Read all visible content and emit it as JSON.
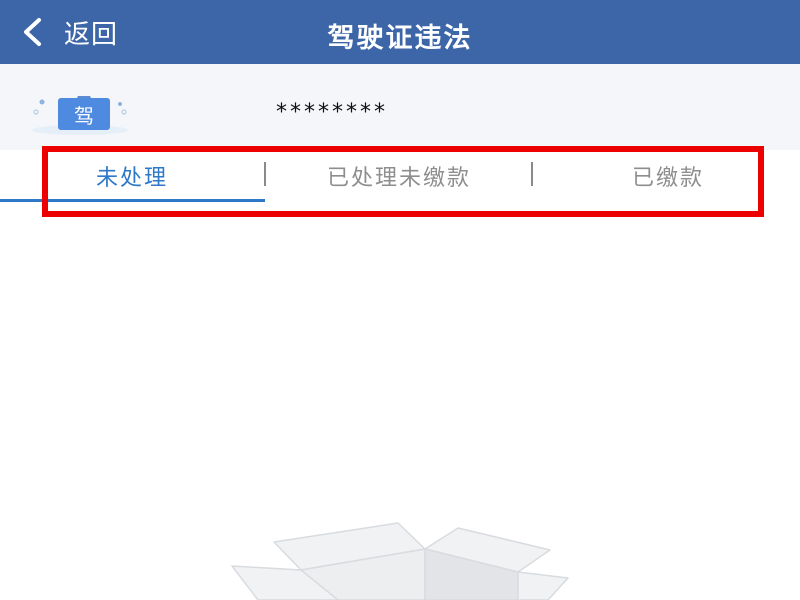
{
  "navbar": {
    "back_label": "返回",
    "title": "驾驶证违法",
    "background_color": "#3C66A8",
    "back_icon": "chevron-left-icon"
  },
  "license": {
    "badge_text": "驾",
    "badge_icon": "driver-license-icon",
    "masked_number": "********"
  },
  "tabs": [
    {
      "label": "未处理",
      "active": true
    },
    {
      "label": "已处理未缴款",
      "active": false
    },
    {
      "label": "已缴款",
      "active": false
    }
  ],
  "colors": {
    "accent": "#2F78C8",
    "inactive_tab": "#8E8E8E",
    "highlight": "#ED0000"
  },
  "empty_state": {
    "icon": "empty-box-icon"
  }
}
